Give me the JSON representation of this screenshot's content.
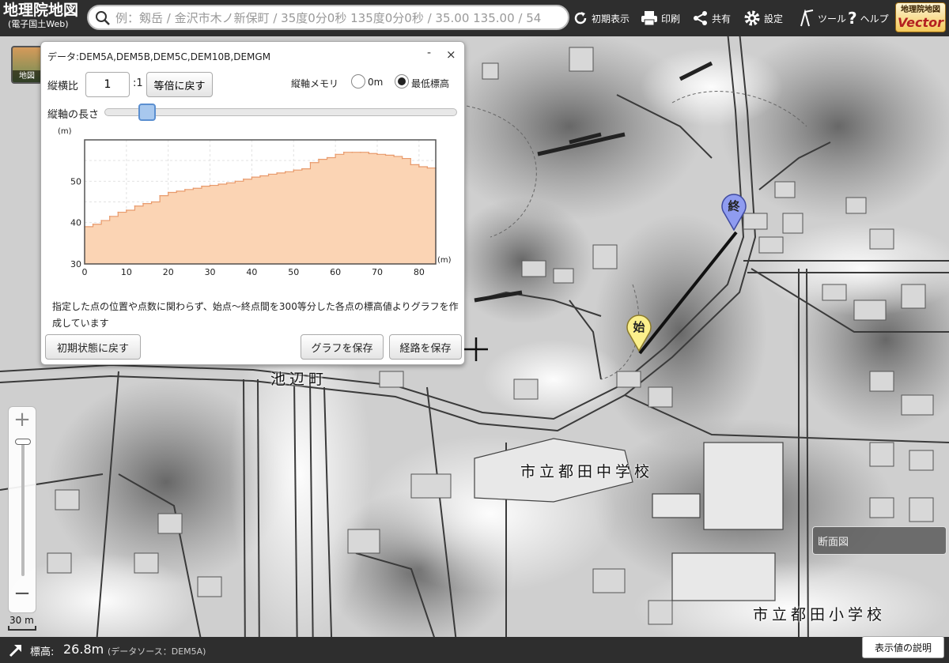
{
  "header": {
    "logo_title": "地理院地図",
    "logo_subtitle": "(電子国土Web)",
    "search_placeholder": "例：剱岳 / 金沢市木ノ新保町 / 35度0分0秒 135度0分0秒 / 35.00 135.00 / 54",
    "buttons": {
      "initial_view": "初期表示",
      "print": "印刷",
      "share": "共有",
      "settings": "設定",
      "tools": "ツール",
      "help": "ヘルプ"
    },
    "vector_top": "地理院地図",
    "vector_bottom": "Vector"
  },
  "basemap": {
    "label": "地図"
  },
  "profile_panel": {
    "title": "データ:DEM5A,DEM5B,DEM5C,DEM10B,DEMGM",
    "minimize": "-",
    "close": "×",
    "ratio_label": "縦横比",
    "ratio_value": "1",
    "ratio_suffix": ":1",
    "reset_ratio_button": "等倍に戻す",
    "memory_label": "縦軸メモリ",
    "memory_options": [
      "0m",
      "最低標高"
    ],
    "memory_selected": "最低標高",
    "vertical_length_label": "縦軸の長さ",
    "vertical_length_level": 0.12,
    "note": "指定した点の位置や点数に関わらず、始点～終点間を300等分した各点の標高値よりグラフを作成しています",
    "reset_button": "初期状態に戻す",
    "save_graph_button": "グラフを保存",
    "save_route_button": "経路を保存"
  },
  "chart_data": {
    "type": "area",
    "xlabel": "(m)",
    "ylabel": "(m)",
    "xlim": [
      0,
      84
    ],
    "ylim": [
      30,
      60
    ],
    "x_ticks": [
      0,
      10,
      20,
      30,
      40,
      50,
      60,
      70,
      80
    ],
    "y_ticks": [
      30,
      40,
      50
    ],
    "grid": true,
    "fill_color": "#fbd4b4",
    "line_color": "#e89a6c",
    "x": [
      0,
      2,
      4,
      6,
      8,
      10,
      12,
      14,
      16,
      18,
      20,
      22,
      24,
      26,
      28,
      30,
      32,
      34,
      36,
      38,
      40,
      42,
      44,
      46,
      48,
      50,
      52,
      54,
      56,
      58,
      60,
      62,
      64,
      66,
      68,
      70,
      72,
      74,
      76,
      78,
      80,
      82,
      84
    ],
    "y": [
      39,
      39.6,
      40.5,
      41.5,
      42.5,
      43,
      44,
      44.6,
      45,
      46.5,
      47.3,
      47.6,
      48,
      48.3,
      48.8,
      49,
      49.3,
      49.6,
      50,
      50.5,
      51,
      51.3,
      51.7,
      52,
      52.3,
      52.7,
      53,
      54.5,
      55.3,
      55.7,
      56.5,
      57,
      57,
      57,
      56.7,
      56.5,
      56.3,
      56,
      55.5,
      54,
      53.5,
      53.2,
      53.2
    ]
  },
  "markers": {
    "start": "始",
    "end": "終"
  },
  "map_labels": {
    "ikenobe": "池辺町",
    "junior_high": "市立都田中学校",
    "elementary": "市立都田小学校"
  },
  "section_label": "断面図",
  "zoom": {
    "in": "+",
    "out": "−",
    "scale": "30 m"
  },
  "status": {
    "elevation_label": "標高:",
    "elevation_value": "26.8m",
    "source": "(データソース：DEM5A)",
    "legend_button": "表示値の説明"
  }
}
